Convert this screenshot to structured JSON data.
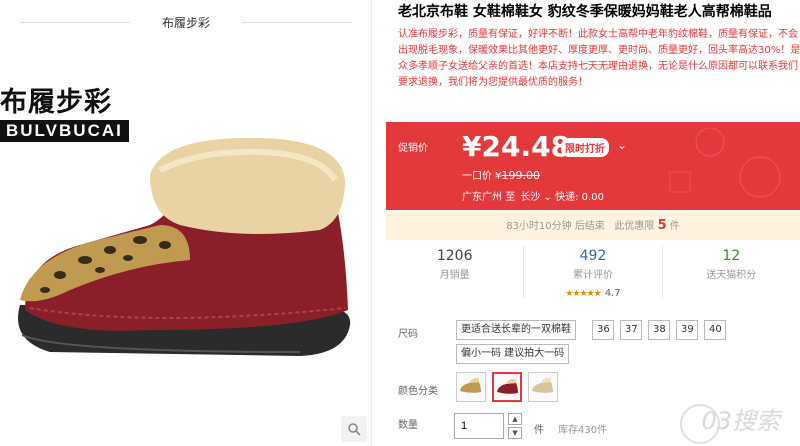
{
  "store": {
    "name": "布履步彩"
  },
  "brand": {
    "cn": "布履步彩",
    "en": "BULVBUCAI"
  },
  "product": {
    "title": "老北京布鞋 女鞋棉鞋女 豹纹冬季保暖妈妈鞋老人高帮棉鞋品",
    "description": "认准布履步彩，质量有保证，好评不断！此款女士高帮中老年豹纹棉鞋，质量有保证，不会出现脱毛现象，保暖效果比其他更好、厚度更厚、更时尚、质量更好，回头率高达30%！是众多孝顺子女送给父亲的首选！本店支持七天无理由退换，无论是什么原因都可以联系我们要求退换，我们将为您提供最优质的服务！"
  },
  "price": {
    "promo_label": "促销价",
    "current": "¥24.48",
    "promo_badge": "限时打折",
    "orig_label": "一口价 ¥",
    "orig_value": "199.00",
    "ship_from": "广东广州",
    "ship_to_word": "至",
    "ship_to": "长沙",
    "express": "快递: 0.00"
  },
  "countdown": {
    "text": "83小时10分钟 后结束",
    "limit_label": "此优惠限",
    "limit_num": "5",
    "limit_unit": "件"
  },
  "stats": [
    {
      "value": "1206",
      "label": "月销量"
    },
    {
      "value": "492",
      "label": "累计评价"
    },
    {
      "value": "12",
      "label": "送天猫积分"
    }
  ],
  "rating": {
    "stars": "★★★★★",
    "score": "4.7"
  },
  "size": {
    "label": "尺码",
    "options": [
      "更适合送长辈的一双棉鞋",
      "36",
      "37",
      "38",
      "39",
      "40",
      "偏小一码 建议拍大一码"
    ]
  },
  "color": {
    "label": "颜色分类"
  },
  "quantity": {
    "label": "数量",
    "value": "1",
    "unit": "件",
    "stock": "库存430件"
  },
  "icons": {
    "zoom": "zoom-icon",
    "chevron": "chevron-down-icon"
  },
  "colors": {
    "accent": "#e4393c",
    "countdown_bg": "#fff3e0"
  },
  "watermark": "03搜索"
}
